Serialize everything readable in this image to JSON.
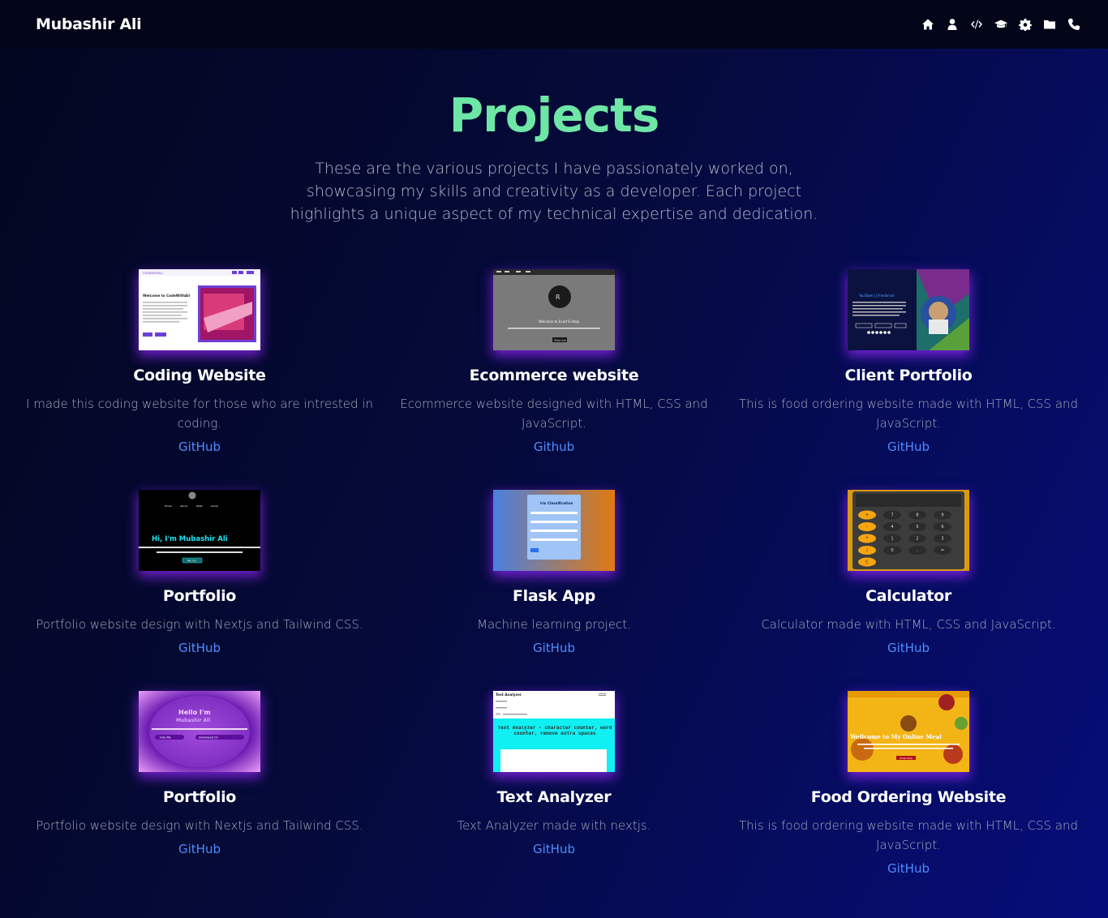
{
  "nav": {
    "brand": "Mubashir Ali",
    "icons": [
      "home-icon",
      "user-icon",
      "code-icon",
      "graduation-cap-icon",
      "gear-icon",
      "folder-icon",
      "phone-icon"
    ]
  },
  "section": {
    "title": "Projects",
    "intro": "These are the various projects I have passionately worked on, showcasing my skills and creativity as a developer. Each project highlights a unique aspect of my technical expertise and dedication."
  },
  "projects": [
    {
      "title": "Coding Website",
      "desc": "I made this coding website for those who are intrested in coding.",
      "link": "GitHub"
    },
    {
      "title": "Ecommerce website",
      "desc": "Ecommerce website designed with HTML, CSS and JavaScript.",
      "link": "Github"
    },
    {
      "title": "Client Portfolio",
      "desc": "This is food ordering website made with HTML, CSS and JavaScript.",
      "link": "GitHub"
    },
    {
      "title": "Portfolio",
      "desc": "Portfolio website design with Nextjs and Tailwind CSS.",
      "link": "GitHub"
    },
    {
      "title": "Flask App",
      "desc": "Machine learning project.",
      "link": "GitHub"
    },
    {
      "title": "Calculator",
      "desc": "Calculator made with HTML, CSS and JavaScript.",
      "link": "GitHub"
    },
    {
      "title": "Portfolio",
      "desc": "Portfolio website design with Nextjs and Tailwind CSS.",
      "link": "GitHub"
    },
    {
      "title": "Text Analyzer",
      "desc": "Text Analyzer made with nextjs.",
      "link": "GitHub"
    },
    {
      "title": "Food Ordering Website",
      "desc": "This is food ordering website made with HTML, CSS and JavaScript.",
      "link": "GitHub"
    }
  ],
  "thumbnails": {
    "coding": {
      "heading": "Welcome to CodeWithAli",
      "nav": "CODEWITHALI"
    },
    "ecommerce": {
      "heading": "Welcome to Ecart E-shop",
      "button": "Shop now"
    },
    "client": {
      "heading": "YouTuber || Freelancer"
    },
    "portfolio1": {
      "heading": "Hi, I'm Mubashir Ali",
      "nav": [
        "Home",
        "About",
        "Skills",
        "Social"
      ],
      "button": "My CV"
    },
    "flask": {
      "heading": "Iris Classification"
    },
    "calculator": {
      "keys": [
        "+",
        "7",
        "8",
        "9",
        "-",
        "4",
        "5",
        "6",
        "*",
        "1",
        "2",
        "3",
        "/",
        "0",
        ".",
        "=",
        "C"
      ]
    },
    "portfolio2": {
      "heading1": "Hello I'm",
      "heading2": "Mubashir Ali",
      "btn1": "Hire Me",
      "btn2": "Download CV"
    },
    "textanalyzer": {
      "nav": "Text Analyzer",
      "heading": "Text Analyzer - character counter, word counter, remove extra spaces"
    },
    "food": {
      "heading": "Wellcome to My Online Meal",
      "button": "Order Now"
    }
  }
}
